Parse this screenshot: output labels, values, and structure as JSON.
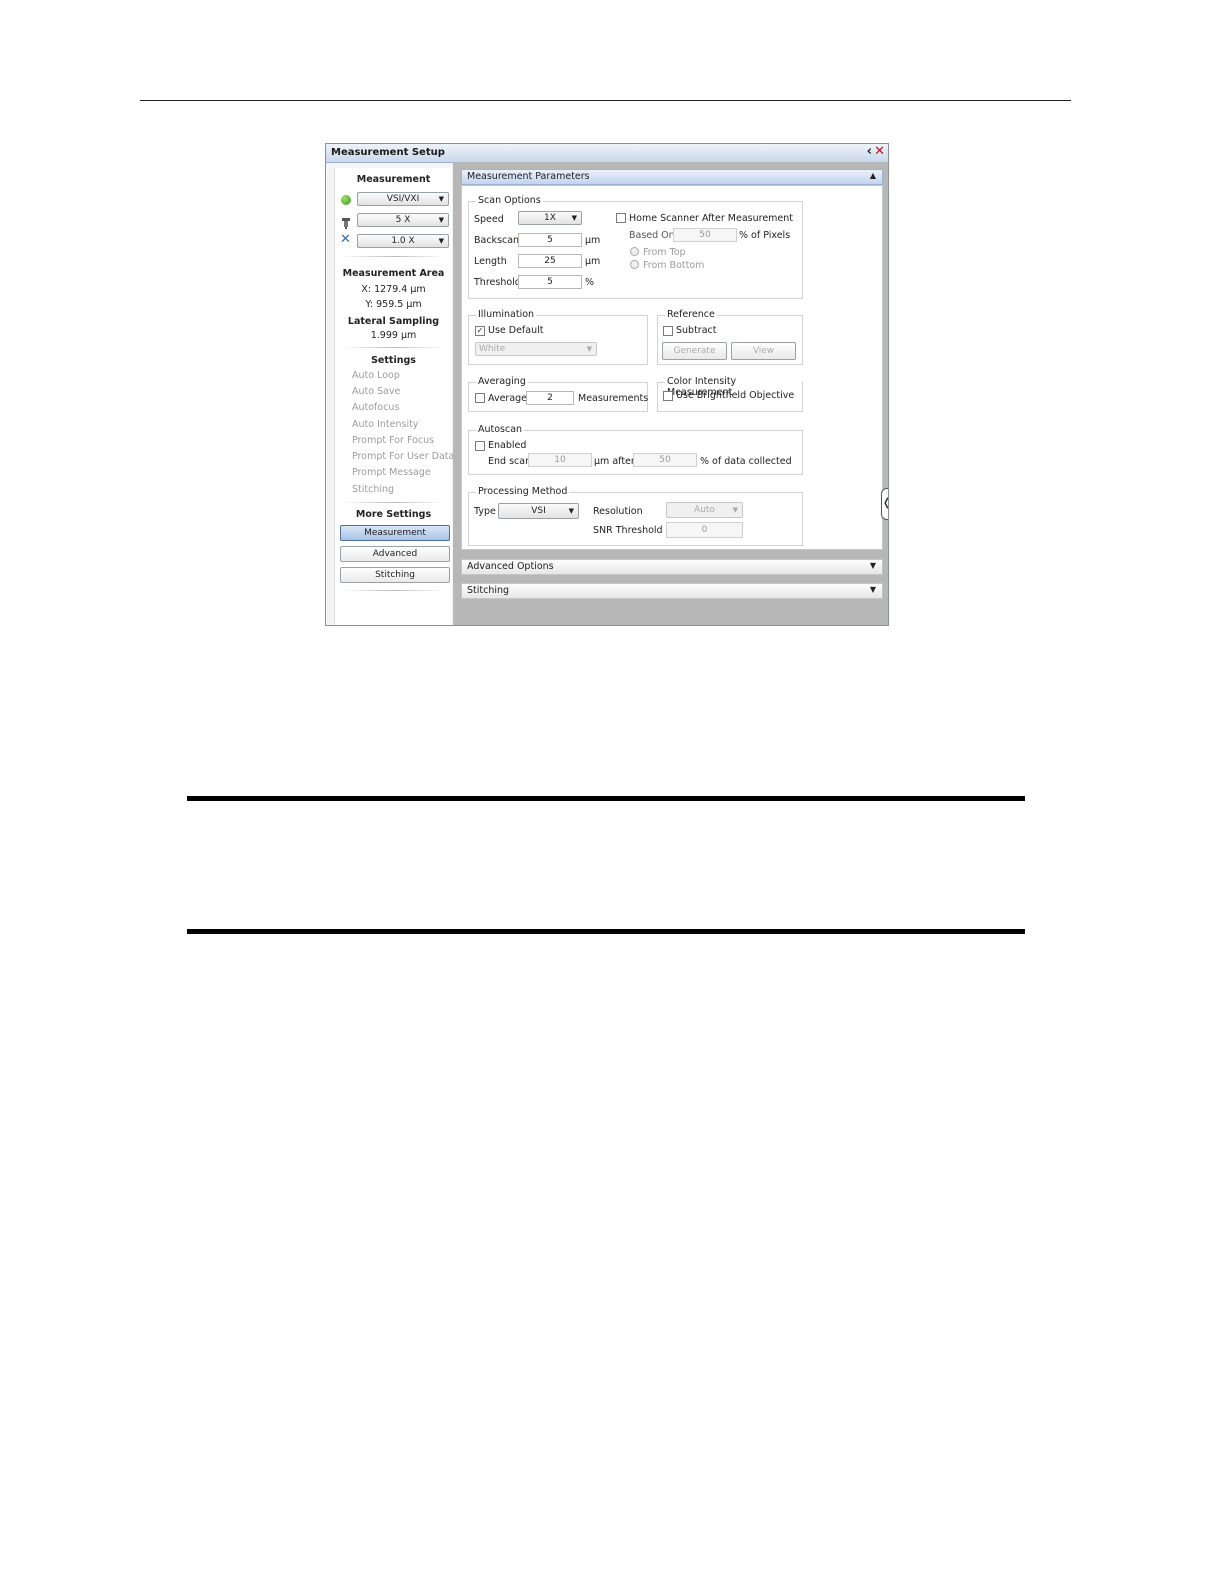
{
  "window": {
    "title": "Measurement Setup"
  },
  "left_panel": {
    "measurement_header": "Measurement",
    "mode": "VSI/VXI",
    "objective": "5 X",
    "zoom": "1.0 X",
    "area_header": "Measurement Area",
    "area_x": "X: 1279.4 µm",
    "area_y": "Y: 959.5 µm",
    "sampling_header": "Lateral Sampling",
    "sampling_value": "1.999 µm",
    "settings_header": "Settings",
    "settings_items": [
      "Auto Loop",
      "Auto Save",
      "Autofocus",
      "Auto Intensity",
      "Prompt For Focus",
      "Prompt For User Data",
      "Prompt Message",
      "Stitching"
    ],
    "more_settings_header": "More Settings",
    "more_buttons": [
      "Measurement",
      "Advanced",
      "Stitching"
    ]
  },
  "params": {
    "header": "Measurement Parameters",
    "scan_options": {
      "title": "Scan Options",
      "speed_label": "Speed",
      "speed": "1X",
      "backscan_label": "Backscan",
      "backscan": "5",
      "backscan_unit": "µm",
      "length_label": "Length",
      "length": "25",
      "length_unit": "µm",
      "threshold_label": "Threshold",
      "threshold": "5",
      "threshold_unit": "%",
      "home_scanner_label": "Home Scanner After Measurement",
      "based_on_label": "Based On",
      "based_on": "50",
      "based_on_unit": "% of Pixels",
      "from_top": "From Top",
      "from_bottom": "From Bottom"
    },
    "illumination": {
      "title": "Illumination",
      "use_default": "Use Default",
      "use_default_checked": true,
      "color": "White"
    },
    "reference": {
      "title": "Reference",
      "subtract": "Subtract",
      "generate": "Generate",
      "view": "View"
    },
    "averaging": {
      "title": "Averaging",
      "average": "Average",
      "count": "2",
      "unit": "Measurements"
    },
    "color_intensity": {
      "title": "Color Intensity Measurement",
      "use_brightfield": "Use Brightfield Objective"
    },
    "autoscan": {
      "title": "Autoscan",
      "enabled": "Enabled",
      "end_scan": "End scan",
      "end_scan_value": "10",
      "after_label": "µm after",
      "after_value": "50",
      "collected_label": "% of data collected"
    },
    "processing": {
      "title": "Processing Method",
      "type_label": "Type",
      "type": "VSI",
      "resolution_label": "Resolution",
      "resolution": "Auto",
      "snr_label": "SNR Threshold",
      "snr": "0"
    }
  },
  "advanced_header": "Advanced Options",
  "stitching_header": "Stitching"
}
